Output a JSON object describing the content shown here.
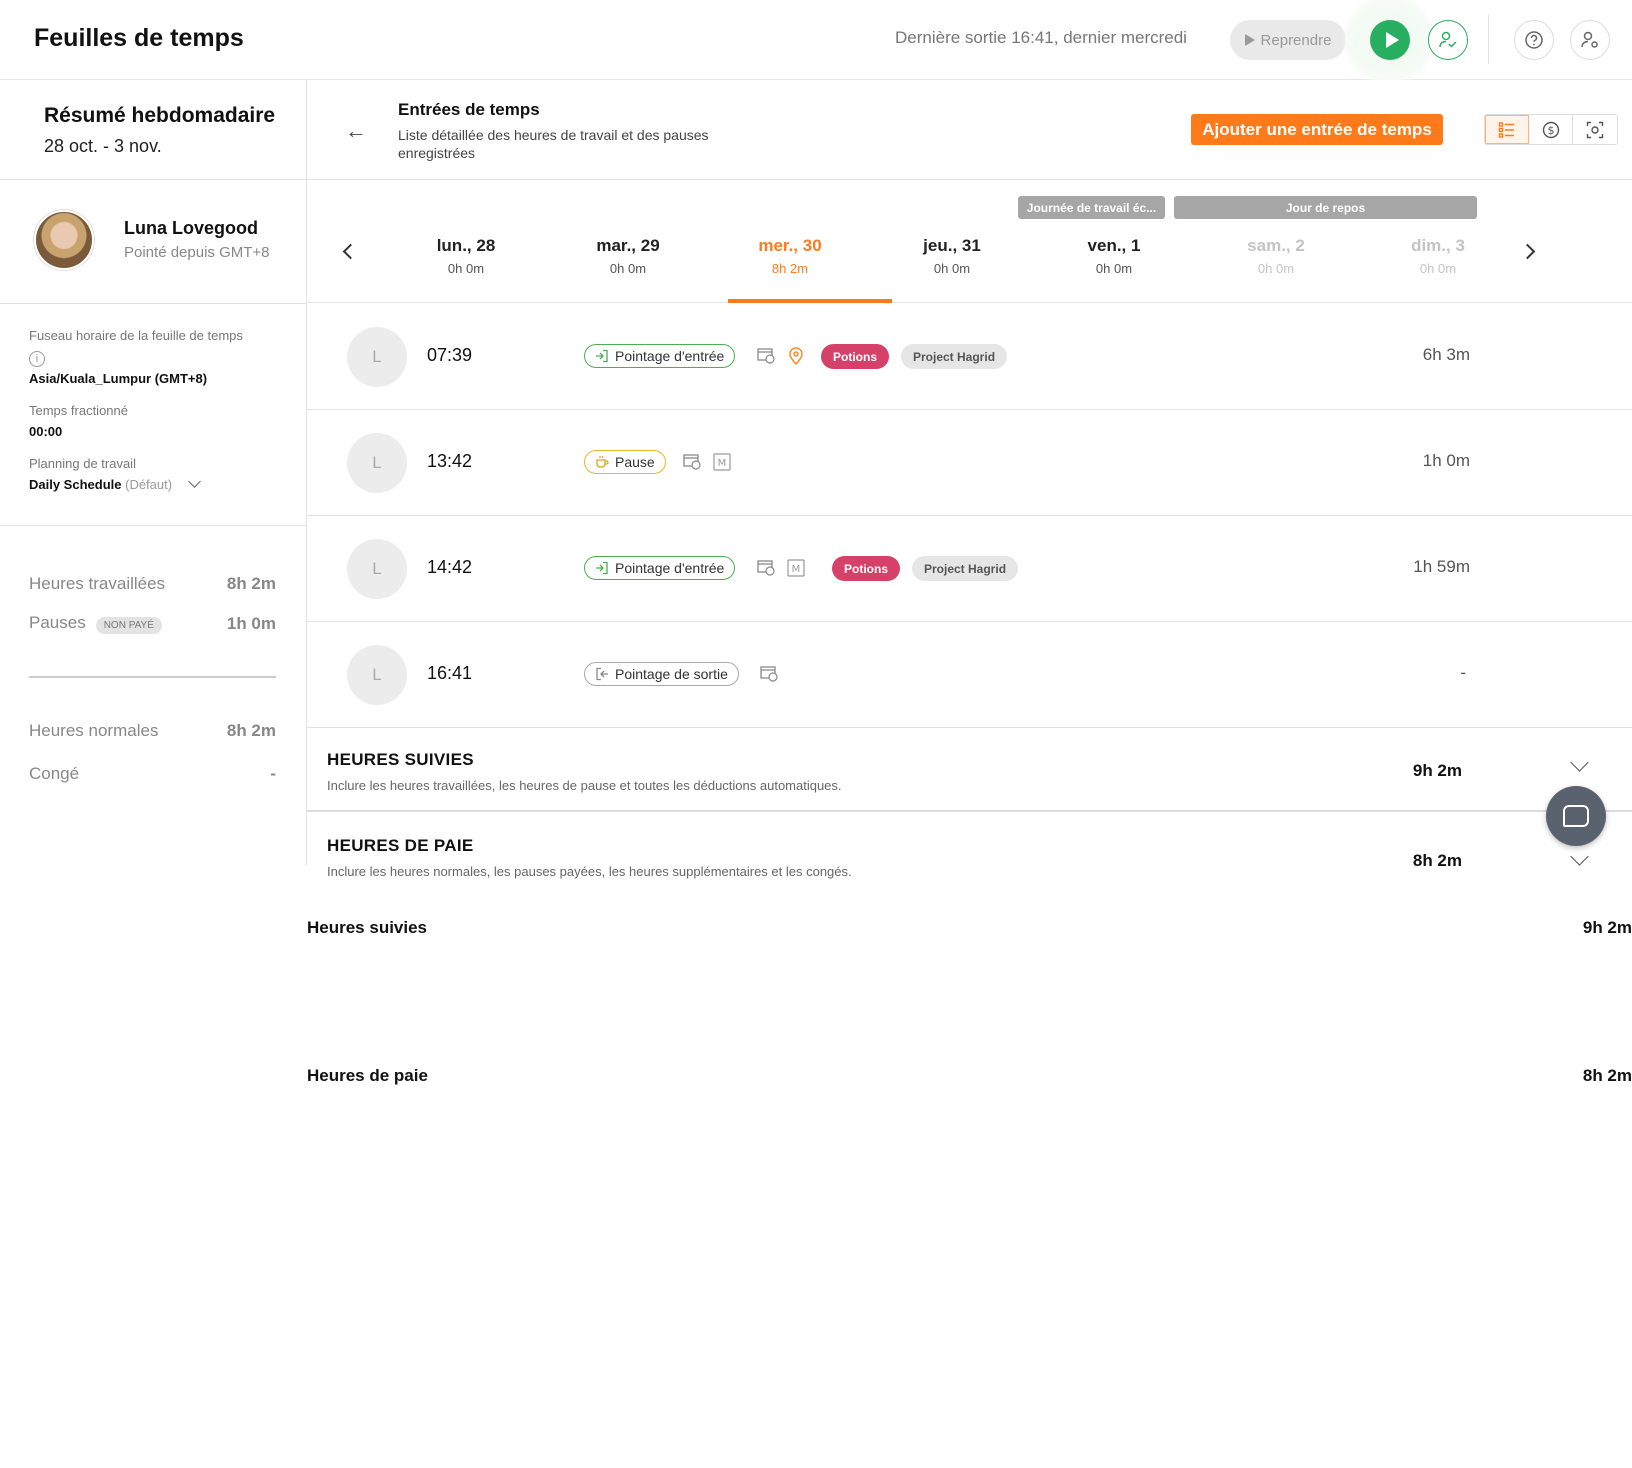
{
  "header": {
    "title": "Feuilles de temps",
    "last_out": "Dernière sortie 16:41, dernier mercredi",
    "resume_label": "Reprendre"
  },
  "sidebar": {
    "week_title": "Résumé hebdomadaire",
    "week_range": "28 oct. - 3 nov.",
    "user_name": "Luna Lovegood",
    "user_sub": "Pointé depuis GMT+8",
    "tz_label": "Fuseau horaire de la feuille de temps",
    "tz_value": "Asia/Kuala_Lumpur (GMT+8)",
    "split_label": "Temps fractionné",
    "split_value": "00:00",
    "sched_label": "Planning de travail",
    "sched_value": "Daily Schedule",
    "sched_default": "(Défaut)",
    "tracked_label": "Heures suivies",
    "tracked_value": "9h 2m",
    "worked_label": "Heures travaillées",
    "worked_value": "8h 2m",
    "breaks_label": "Pauses",
    "breaks_badge": "NON PAYÉ",
    "breaks_value": "1h 0m",
    "payroll_label": "Heures de paie",
    "payroll_value": "8h 2m",
    "regular_label": "Heures normales",
    "regular_value": "8h 2m",
    "leave_label": "Congé",
    "leave_value": "-"
  },
  "section": {
    "title": "Entrées de temps",
    "desc": "Liste détaillée des heures de travail et des pauses enregistrées",
    "add_label": "Ajouter une entrée de temps"
  },
  "day_badges": {
    "workday": "Journée de travail éc...",
    "rest": "Jour de repos"
  },
  "days": [
    {
      "name": "lun., 28",
      "hours": "0h 0m"
    },
    {
      "name": "mar., 29",
      "hours": "0h 0m"
    },
    {
      "name": "mer., 30",
      "hours": "8h 2m"
    },
    {
      "name": "jeu., 31",
      "hours": "0h 0m"
    },
    {
      "name": "ven., 1",
      "hours": "0h 0m"
    },
    {
      "name": "sam., 2",
      "hours": "0h 0m"
    },
    {
      "name": "dim., 3",
      "hours": "0h 0m"
    }
  ],
  "entries": [
    {
      "avatar": "L",
      "time": "07:39",
      "type": "Pointage d'entrée",
      "tag1": "Potions",
      "tag2": "Project Hagrid",
      "duration": "6h 3m"
    },
    {
      "avatar": "L",
      "time": "13:42",
      "type": "Pause",
      "duration": "1h 0m",
      "m": "M"
    },
    {
      "avatar": "L",
      "time": "14:42",
      "type": "Pointage d'entrée",
      "tag1": "Potions",
      "tag2": "Project Hagrid",
      "duration": "1h 59m",
      "m": "M"
    },
    {
      "avatar": "L",
      "time": "16:41",
      "type": "Pointage de sortie",
      "duration": "-"
    }
  ],
  "summary": {
    "tracked_title": "HEURES SUIVIES",
    "tracked_desc": "Inclure les heures travaillées, les heures de pause et toutes les déductions automatiques.",
    "tracked_value": "9h 2m",
    "pay_title": "HEURES DE PAIE",
    "pay_desc": "Inclure les heures normales, les pauses payées, les heures supplémentaires et les congés.",
    "pay_value": "8h 2m"
  },
  "colors": {
    "accent": "#ff7a1a",
    "green": "#27ae60",
    "potions": "#d6416a"
  }
}
